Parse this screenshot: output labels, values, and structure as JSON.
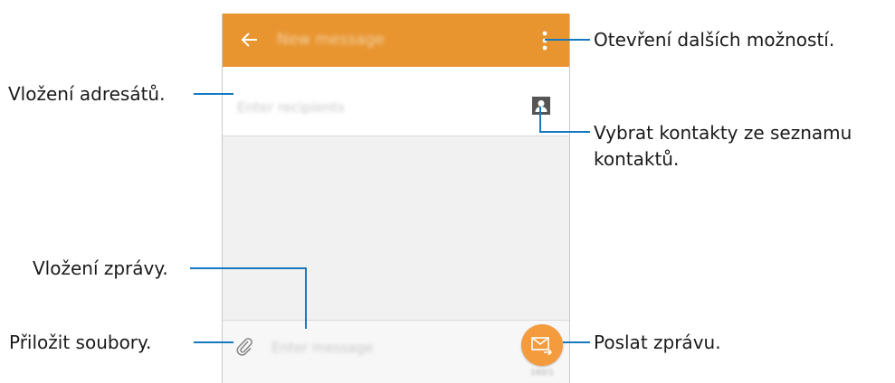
{
  "screen": {
    "toolbar": {
      "title": "New message",
      "accent_color": "#e89530",
      "back_icon": "arrow-left-icon",
      "more_icon": "more-vertical-icon"
    },
    "recipients": {
      "placeholder": "Enter recipients",
      "contact_icon": "contact-card-icon"
    },
    "composer": {
      "placeholder": "Enter message",
      "attach_icon": "paperclip-icon",
      "send_icon": "send-envelope-icon",
      "send_counter": "160/1",
      "send_button_color": "#f39b3d"
    }
  },
  "callouts": {
    "more_options": "Otevření dalších možností.",
    "add_recipients": "Vložení adresátů.",
    "choose_contacts_line1": "Vybrat kontakty ze seznamu",
    "choose_contacts_line2": "kontaktů.",
    "enter_message": "Vložení zprávy.",
    "attach_files": "Přiložit soubory.",
    "send_message": "Poslat zprávu.",
    "line_color": "#1579c1"
  }
}
